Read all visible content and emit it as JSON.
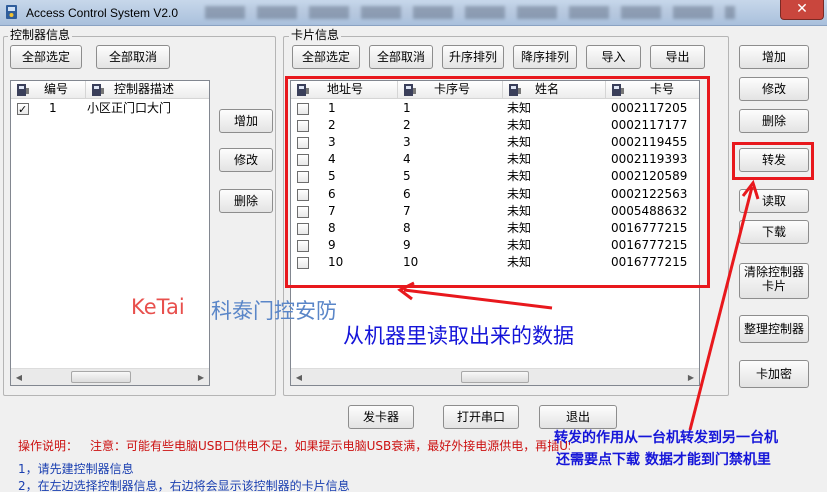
{
  "window": {
    "title": "Access Control System   V2.0",
    "close_glyph": "✕"
  },
  "controller_panel": {
    "label": "控制器信息",
    "select_all": "全部选定",
    "deselect_all": "全部取消",
    "columns": [
      "编号",
      "控制器描述"
    ],
    "rows": [
      {
        "checked": true,
        "id": "1",
        "desc": "小区正门口大门"
      }
    ],
    "add": "增加",
    "modify": "修改",
    "delete": "删除"
  },
  "card_panel": {
    "label": "卡片信息",
    "select_all": "全部选定",
    "deselect_all": "全部取消",
    "sort_asc": "升序排列",
    "sort_desc": "降序排列",
    "import": "导入",
    "export": "导出",
    "columns": [
      "地址号",
      "卡序号",
      "姓名",
      "卡号"
    ],
    "rows": [
      {
        "addr": "1",
        "seq": "1",
        "name": "未知",
        "card": "0002117205"
      },
      {
        "addr": "2",
        "seq": "2",
        "name": "未知",
        "card": "0002117177"
      },
      {
        "addr": "3",
        "seq": "3",
        "name": "未知",
        "card": "0002119455"
      },
      {
        "addr": "4",
        "seq": "4",
        "name": "未知",
        "card": "0002119393"
      },
      {
        "addr": "5",
        "seq": "5",
        "name": "未知",
        "card": "0002120589"
      },
      {
        "addr": "6",
        "seq": "6",
        "name": "未知",
        "card": "0002122563"
      },
      {
        "addr": "7",
        "seq": "7",
        "name": "未知",
        "card": "0005488632"
      },
      {
        "addr": "8",
        "seq": "8",
        "name": "未知",
        "card": "0016777215"
      },
      {
        "addr": "9",
        "seq": "9",
        "name": "未知",
        "card": "0016777215"
      },
      {
        "addr": "10",
        "seq": "10",
        "name": "未知",
        "card": "0016777215"
      }
    ]
  },
  "right_buttons": {
    "add": "增加",
    "modify": "修改",
    "delete": "删除",
    "forward": "转发",
    "read": "读取",
    "download": "下载",
    "clear_controller_card": "清除控制器卡片",
    "organize_controller": "整理控制器",
    "card_encrypt": "卡加密"
  },
  "bottom_buttons": {
    "issuer": "发卡器",
    "open_port": "打开串口",
    "exit": "退出"
  },
  "status": {
    "prefix": "操作说明：",
    "note": "注意：可能有些电脑USB口供电不足，如果提示电脑USB衰满，最好外接电源供电，再插USB口",
    "step1": "1，请先建控制器信息",
    "step2": "2，在左边选择控制器信息，右边将会显示该控制器的卡片信息"
  },
  "annotations": {
    "watermark_en": "KeTai",
    "watermark_cn": "科泰门控安防",
    "data_note": "从机器里读取出来的数据",
    "forward_note_1": "转发的作用从一台机转发到另一台机",
    "forward_note_2": "还需要点下载 数据才能到门禁机里"
  },
  "colors": {
    "highlight_red": "#e8181d",
    "watermark_red": "#e8504d",
    "watermark_blue": "#5a86c8",
    "note_blue": "#1515d9",
    "status_red": "#cc1010",
    "status_blue": "#1a3fb0"
  }
}
